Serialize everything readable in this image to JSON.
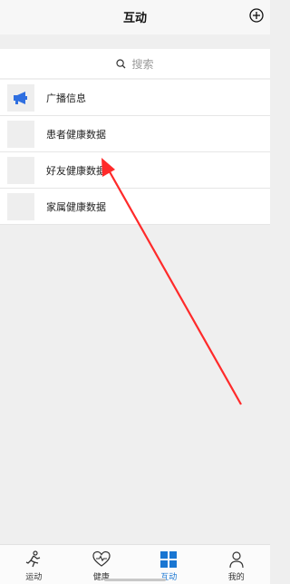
{
  "header": {
    "title": "互动"
  },
  "search": {
    "placeholder": "搜索"
  },
  "list": {
    "items": [
      {
        "label": "广播信息",
        "icon": "megaphone-icon"
      },
      {
        "label": "患者健康数据"
      },
      {
        "label": "好友健康数据"
      },
      {
        "label": "家属健康数据"
      }
    ]
  },
  "tabbar": {
    "tabs": [
      {
        "label": "运动",
        "icon": "running-icon"
      },
      {
        "label": "健康",
        "icon": "heart-pulse-icon"
      },
      {
        "label": "互动",
        "icon": "grid-icon",
        "active": true
      },
      {
        "label": "我的",
        "icon": "person-icon"
      }
    ],
    "active_color": "#1976d2"
  },
  "annotation": {
    "arrow_color": "#ff2a2a"
  }
}
